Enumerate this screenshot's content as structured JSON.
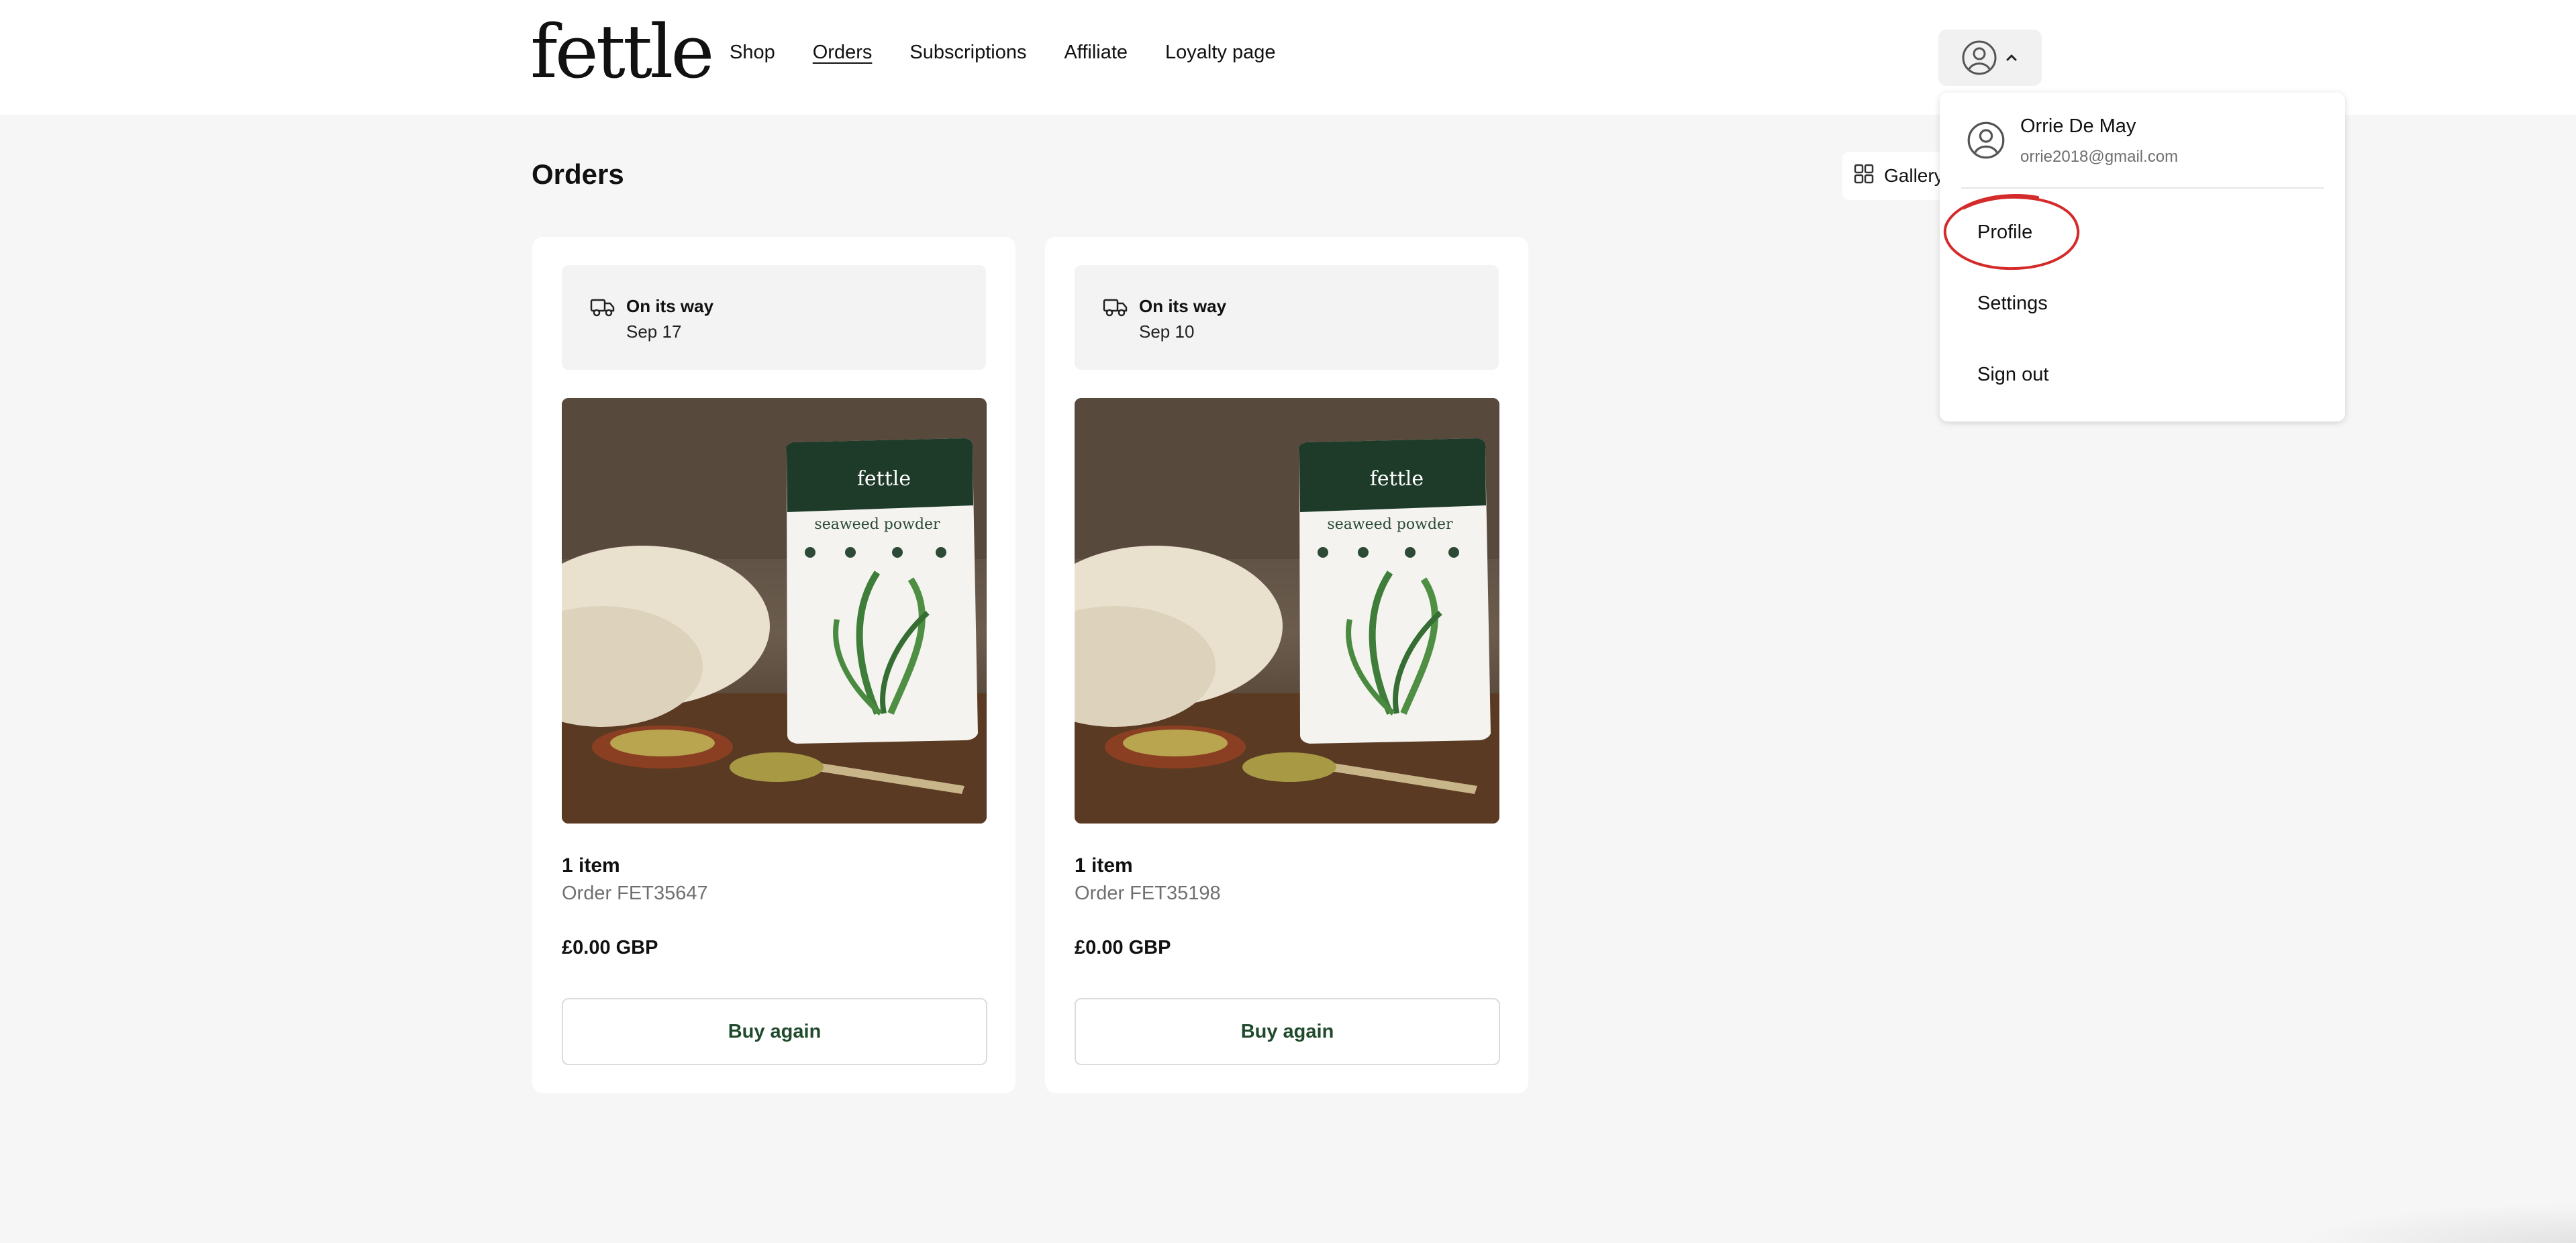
{
  "header": {
    "logo": "fettle",
    "nav": [
      "Shop",
      "Orders",
      "Subscriptions",
      "Affiliate",
      "Loyalty page"
    ],
    "active_nav": "Orders",
    "account_icon": "user-circle-icon"
  },
  "main": {
    "title": "Orders",
    "view_toggle_label": "Gallery"
  },
  "orders": [
    {
      "status": "On its way",
      "date": "Sep 17",
      "items": "1 item",
      "order_number": "Order FET35647",
      "total": "£0.00 GBP",
      "button": "Buy again",
      "product_image": "seaweed-powder-pouch"
    },
    {
      "status": "On its way",
      "date": "Sep 10",
      "items": "1 item",
      "order_number": "Order FET35198",
      "total": "£0.00 GBP",
      "button": "Buy again",
      "product_image": "seaweed-powder-pouch"
    }
  ],
  "account_menu": {
    "name": "Orrie De May",
    "email": "orrie2018@gmail.com",
    "items": [
      "Profile",
      "Settings",
      "Sign out"
    ],
    "highlighted_item": "Profile"
  },
  "colors": {
    "background": "#f6f6f6",
    "surface": "#ffffff",
    "button_text": "#1f4a2c",
    "highlight_ring": "#d42a2a",
    "pouch_green": "#1e3a28"
  }
}
